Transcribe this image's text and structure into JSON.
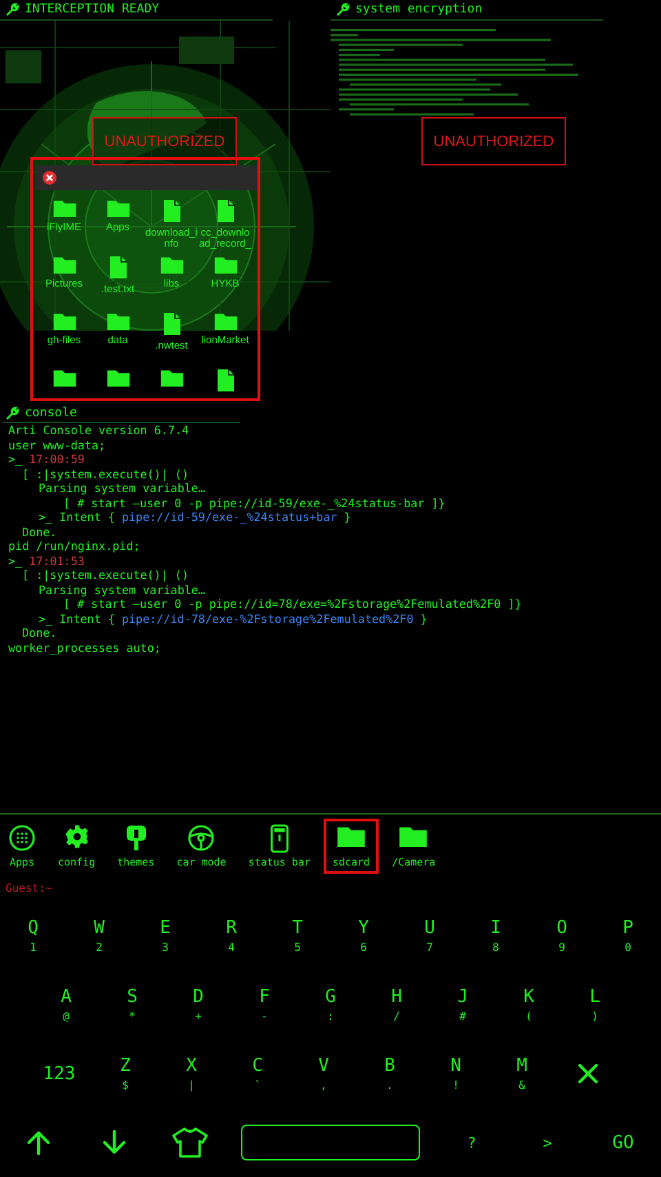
{
  "panels": [
    {
      "title": "INTERCEPTION READY",
      "kind": "radar",
      "warning": "UNAUTHORIZED"
    },
    {
      "title": "system encryption",
      "kind": "code",
      "warning": "UNAUTHORIZED"
    }
  ],
  "file_dialog": {
    "items": [
      {
        "kind": "folder",
        "label": "iFlyIME"
      },
      {
        "kind": "folder",
        "label": "Apps"
      },
      {
        "kind": "file",
        "label": "download_info"
      },
      {
        "kind": "file",
        "label": "cc_download_record_"
      },
      {
        "kind": "folder",
        "label": "Pictures"
      },
      {
        "kind": "file",
        "label": ".test.txt"
      },
      {
        "kind": "folder",
        "label": "libs"
      },
      {
        "kind": "folder",
        "label": "HYKB"
      },
      {
        "kind": "folder",
        "label": "gh-files"
      },
      {
        "kind": "folder",
        "label": "data"
      },
      {
        "kind": "file",
        "label": ".nwtest"
      },
      {
        "kind": "folder",
        "label": "lionMarket"
      },
      {
        "kind": "folder"
      },
      {
        "kind": "folder"
      },
      {
        "kind": "folder"
      },
      {
        "kind": "file"
      }
    ]
  },
  "console": {
    "title": "console",
    "lines": [
      {
        "kind": "plain",
        "text": "Arti Console version 6.7.4"
      },
      {
        "kind": "plain",
        "text": "user www-data;"
      },
      {
        "kind": "time",
        "prompt": ">_",
        "text": "17:00:59"
      },
      {
        "kind": "call",
        "text": "[ :|system.execute()| ()"
      },
      {
        "kind": "parse",
        "text": "Parsing system variable…"
      },
      {
        "kind": "cmd",
        "text": "[ # start —user 0 -p pipe://id-59/exe-_%24status-bar ]}"
      },
      {
        "kind": "intent",
        "prefix": ">_ Intent {",
        "link": "pipe://id-59/exe-_%24status+bar",
        "suffix": "}"
      },
      {
        "kind": "done",
        "text": "Done."
      },
      {
        "kind": "plain",
        "text": "pid /run/nginx.pid;"
      },
      {
        "kind": "time",
        "prompt": ">_",
        "text": "17:01:53"
      },
      {
        "kind": "call",
        "text": "[ :|system.execute()| ()"
      },
      {
        "kind": "parse",
        "text": "Parsing system variable…"
      },
      {
        "kind": "cmd",
        "text": "[ # start —user 0 -p pipe://id=78/exe=%2Fstorage%2Femulated%2F0 ]}"
      },
      {
        "kind": "intent",
        "prefix": ">_ Intent {",
        "link": "pipe://id-78/exe-%2Fstorage%2Femulated%2F0",
        "suffix": "}"
      },
      {
        "kind": "done",
        "text": "Done."
      },
      {
        "kind": "plain",
        "text": "worker_processes auto;"
      }
    ]
  },
  "shortcuts": [
    {
      "label": "Apps",
      "selected": false
    },
    {
      "label": "config",
      "selected": false
    },
    {
      "label": "themes",
      "selected": false
    },
    {
      "label": "car mode",
      "selected": false
    },
    {
      "label": "status bar",
      "selected": false
    },
    {
      "label": "sdcard",
      "selected": true
    },
    {
      "label": "/Camera",
      "selected": false
    }
  ],
  "prompt": "Guest:~",
  "keyboard": {
    "rows": [
      [
        {
          "kind": "letter",
          "label": "Q",
          "sub": "1"
        },
        {
          "kind": "letter",
          "label": "W",
          "sub": "2"
        },
        {
          "kind": "letter",
          "label": "E",
          "sub": "3"
        },
        {
          "kind": "letter",
          "label": "R",
          "sub": "4"
        },
        {
          "kind": "letter",
          "label": "T",
          "sub": "5"
        },
        {
          "kind": "letter",
          "label": "Y",
          "sub": "6"
        },
        {
          "kind": "letter",
          "label": "U",
          "sub": "7"
        },
        {
          "kind": "letter",
          "label": "I",
          "sub": "8"
        },
        {
          "kind": "letter",
          "label": "O",
          "sub": "9"
        },
        {
          "kind": "letter",
          "label": "P",
          "sub": "0"
        }
      ],
      [
        {
          "kind": "letter",
          "label": "A",
          "sub": "@"
        },
        {
          "kind": "letter",
          "label": "S",
          "sub": "*"
        },
        {
          "kind": "letter",
          "label": "D",
          "sub": "+"
        },
        {
          "kind": "letter",
          "label": "F",
          "sub": "-"
        },
        {
          "kind": "letter",
          "label": "G",
          "sub": ":"
        },
        {
          "kind": "letter",
          "label": "H",
          "sub": "/"
        },
        {
          "kind": "letter",
          "label": "J",
          "sub": "#"
        },
        {
          "kind": "letter",
          "label": "K",
          "sub": "("
        },
        {
          "kind": "letter",
          "label": "L",
          "sub": ")"
        }
      ],
      [
        {
          "kind": "text",
          "label": "123"
        },
        {
          "kind": "letter",
          "label": "Z",
          "sub": "$"
        },
        {
          "kind": "letter",
          "label": "X",
          "sub": "|"
        },
        {
          "kind": "letter",
          "label": "C",
          "sub": "`"
        },
        {
          "kind": "letter",
          "label": "V",
          "sub": ","
        },
        {
          "kind": "letter",
          "label": "B",
          "sub": "."
        },
        {
          "kind": "letter",
          "label": "N",
          "sub": "!"
        },
        {
          "kind": "letter",
          "label": "M",
          "sub": "&"
        },
        {
          "kind": "delete"
        }
      ]
    ],
    "controls": [
      {
        "kind": "up"
      },
      {
        "kind": "down"
      },
      {
        "kind": "shirt"
      },
      {
        "kind": "space"
      },
      {
        "kind": "text",
        "label": "?"
      },
      {
        "kind": "text",
        "label": ">"
      },
      {
        "kind": "text",
        "label": "GO"
      }
    ]
  }
}
